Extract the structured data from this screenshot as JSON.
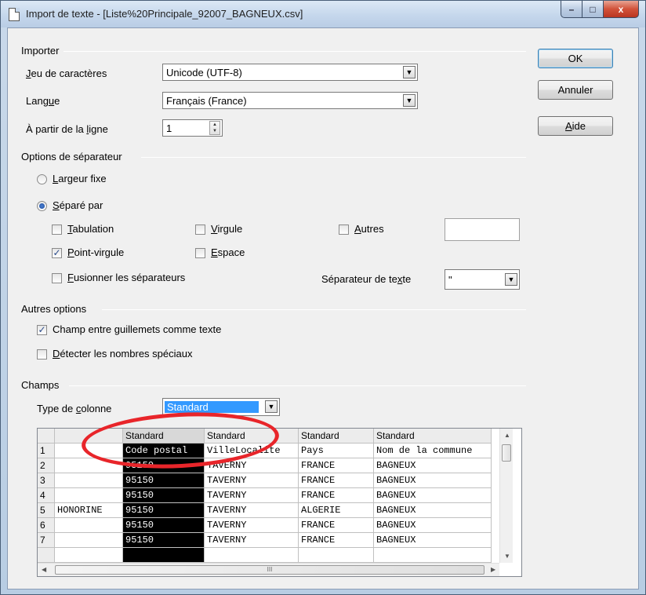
{
  "window": {
    "title": "Import de texte - [Liste%20Principale_92007_BAGNEUX.csv]",
    "controls": {
      "minimize": "–",
      "maximize": "□",
      "close": "x"
    }
  },
  "buttons": {
    "ok": "OK",
    "cancel": "Annuler",
    "help_pre": "",
    "help_u": "A",
    "help_post": "ide"
  },
  "importer": {
    "group": "Importer",
    "charset_label_u": "J",
    "charset_label_rest": "eu de caractères",
    "charset_value": "Unicode (UTF-8)",
    "language_label_pre": "Lang",
    "language_label_u": "u",
    "language_label_post": "e",
    "language_value": "Français (France)",
    "from_line_label_pre": "À partir de la ",
    "from_line_label_u": "l",
    "from_line_label_post": "igne",
    "from_line_value": "1"
  },
  "separator": {
    "group": "Options de séparateur",
    "fixed_width_u": "L",
    "fixed_width_rest": "argeur fixe",
    "separated_by_u": "S",
    "separated_by_rest": "éparé par",
    "tab_u": "T",
    "tab_rest": "abulation",
    "comma_u": "V",
    "comma_rest": "irgule",
    "other_u": "A",
    "other_rest": "utres",
    "semicolon_u": "P",
    "semicolon_rest": "oint-virgule",
    "space_u": "E",
    "space_rest": "space",
    "merge_u": "F",
    "merge_rest": "usionner les séparateurs",
    "text_sep_label_pre": "Séparateur de te",
    "text_sep_label_u": "x",
    "text_sep_label_post": "te",
    "text_sep_value": "\"",
    "semicolon_checked": "✓"
  },
  "other_options": {
    "group": "Autres options",
    "quoted_pre": "Champ entre ",
    "quoted_u": "g",
    "quoted_post": "uillemets comme texte",
    "quoted_checked": "✓",
    "detect_u": "D",
    "detect_rest": "étecter les nombres spéciaux"
  },
  "fields": {
    "group": "Champs",
    "column_type_label_pre": "Type de ",
    "column_type_label_u": "c",
    "column_type_label_post": "olonne",
    "column_type_value": "Standard"
  },
  "preview": {
    "headers": [
      "Standard",
      "Standard",
      "Standard",
      "Standard"
    ],
    "rows": [
      {
        "n": "1",
        "pre": "",
        "c1": "Code postal",
        "c2": "VilleLocalite",
        "c3": "Pays",
        "c4": "Nom de la commune"
      },
      {
        "n": "2",
        "pre": "",
        "c1": "95150",
        "c2": "TAVERNY",
        "c3": "FRANCE",
        "c4": "BAGNEUX"
      },
      {
        "n": "3",
        "pre": "",
        "c1": "95150",
        "c2": "TAVERNY",
        "c3": "FRANCE",
        "c4": "BAGNEUX"
      },
      {
        "n": "4",
        "pre": "",
        "c1": "95150",
        "c2": "TAVERNY",
        "c3": "FRANCE",
        "c4": "BAGNEUX"
      },
      {
        "n": "5",
        "pre": "HONORINE",
        "c1": "95150",
        "c2": "TAVERNY",
        "c3": "ALGERIE",
        "c4": "BAGNEUX"
      },
      {
        "n": "6",
        "pre": "",
        "c1": "95150",
        "c2": "TAVERNY",
        "c3": "FRANCE",
        "c4": "BAGNEUX"
      },
      {
        "n": "7",
        "pre": "",
        "c1": "95150",
        "c2": "TAVERNY",
        "c3": "FRANCE",
        "c4": "BAGNEUX"
      }
    ],
    "hscroll_marker": "III"
  }
}
